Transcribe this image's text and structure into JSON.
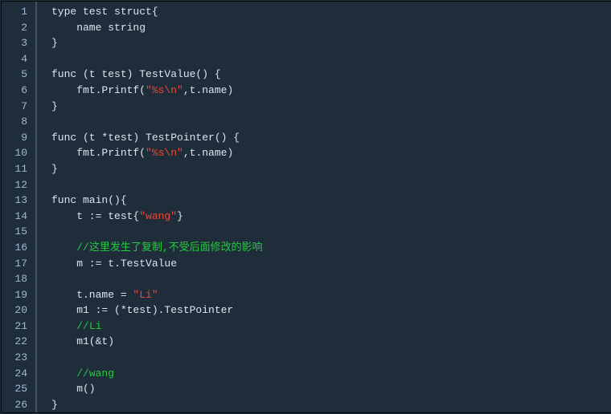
{
  "editor": {
    "lines": [
      {
        "n": 1,
        "tokens": [
          {
            "t": "type test struct{",
            "c": "kw"
          }
        ]
      },
      {
        "n": 2,
        "tokens": [
          {
            "t": "    name string",
            "c": "kw"
          }
        ]
      },
      {
        "n": 3,
        "tokens": [
          {
            "t": "}",
            "c": "kw"
          }
        ]
      },
      {
        "n": 4,
        "tokens": []
      },
      {
        "n": 5,
        "tokens": [
          {
            "t": "func (t test) TestValue() {",
            "c": "kw"
          }
        ]
      },
      {
        "n": 6,
        "tokens": [
          {
            "t": "    fmt.Printf(",
            "c": "kw"
          },
          {
            "t": "\"%s\\n\"",
            "c": "str"
          },
          {
            "t": ",t.name)",
            "c": "kw"
          }
        ]
      },
      {
        "n": 7,
        "tokens": [
          {
            "t": "}",
            "c": "kw"
          }
        ]
      },
      {
        "n": 8,
        "tokens": []
      },
      {
        "n": 9,
        "tokens": [
          {
            "t": "func (t *test) TestPointer() {",
            "c": "kw"
          }
        ]
      },
      {
        "n": 10,
        "tokens": [
          {
            "t": "    fmt.Printf(",
            "c": "kw"
          },
          {
            "t": "\"%s\\n\"",
            "c": "str"
          },
          {
            "t": ",t.name)",
            "c": "kw"
          }
        ]
      },
      {
        "n": 11,
        "tokens": [
          {
            "t": "}",
            "c": "kw"
          }
        ]
      },
      {
        "n": 12,
        "tokens": []
      },
      {
        "n": 13,
        "tokens": [
          {
            "t": "func main(){",
            "c": "kw"
          }
        ]
      },
      {
        "n": 14,
        "tokens": [
          {
            "t": "    t := test{",
            "c": "kw"
          },
          {
            "t": "\"wang\"",
            "c": "str"
          },
          {
            "t": "}",
            "c": "kw"
          }
        ]
      },
      {
        "n": 15,
        "tokens": []
      },
      {
        "n": 16,
        "tokens": [
          {
            "t": "    ",
            "c": "kw"
          },
          {
            "t": "//这里发生了复制,不受后面修改的影响",
            "c": "cmt"
          }
        ]
      },
      {
        "n": 17,
        "tokens": [
          {
            "t": "    m := t.TestValue",
            "c": "kw"
          }
        ]
      },
      {
        "n": 18,
        "tokens": []
      },
      {
        "n": 19,
        "tokens": [
          {
            "t": "    t.name = ",
            "c": "kw"
          },
          {
            "t": "\"Li\"",
            "c": "str"
          }
        ]
      },
      {
        "n": 20,
        "tokens": [
          {
            "t": "    m1 := (*test).TestPointer",
            "c": "kw"
          }
        ]
      },
      {
        "n": 21,
        "tokens": [
          {
            "t": "    ",
            "c": "kw"
          },
          {
            "t": "//Li",
            "c": "cmt"
          }
        ]
      },
      {
        "n": 22,
        "tokens": [
          {
            "t": "    m1(&t)",
            "c": "kw"
          }
        ]
      },
      {
        "n": 23,
        "tokens": []
      },
      {
        "n": 24,
        "tokens": [
          {
            "t": "    ",
            "c": "kw"
          },
          {
            "t": "//wang",
            "c": "cmt"
          }
        ]
      },
      {
        "n": 25,
        "tokens": [
          {
            "t": "    m()",
            "c": "kw"
          }
        ]
      },
      {
        "n": 26,
        "tokens": [
          {
            "t": "}",
            "c": "kw"
          }
        ]
      }
    ]
  }
}
